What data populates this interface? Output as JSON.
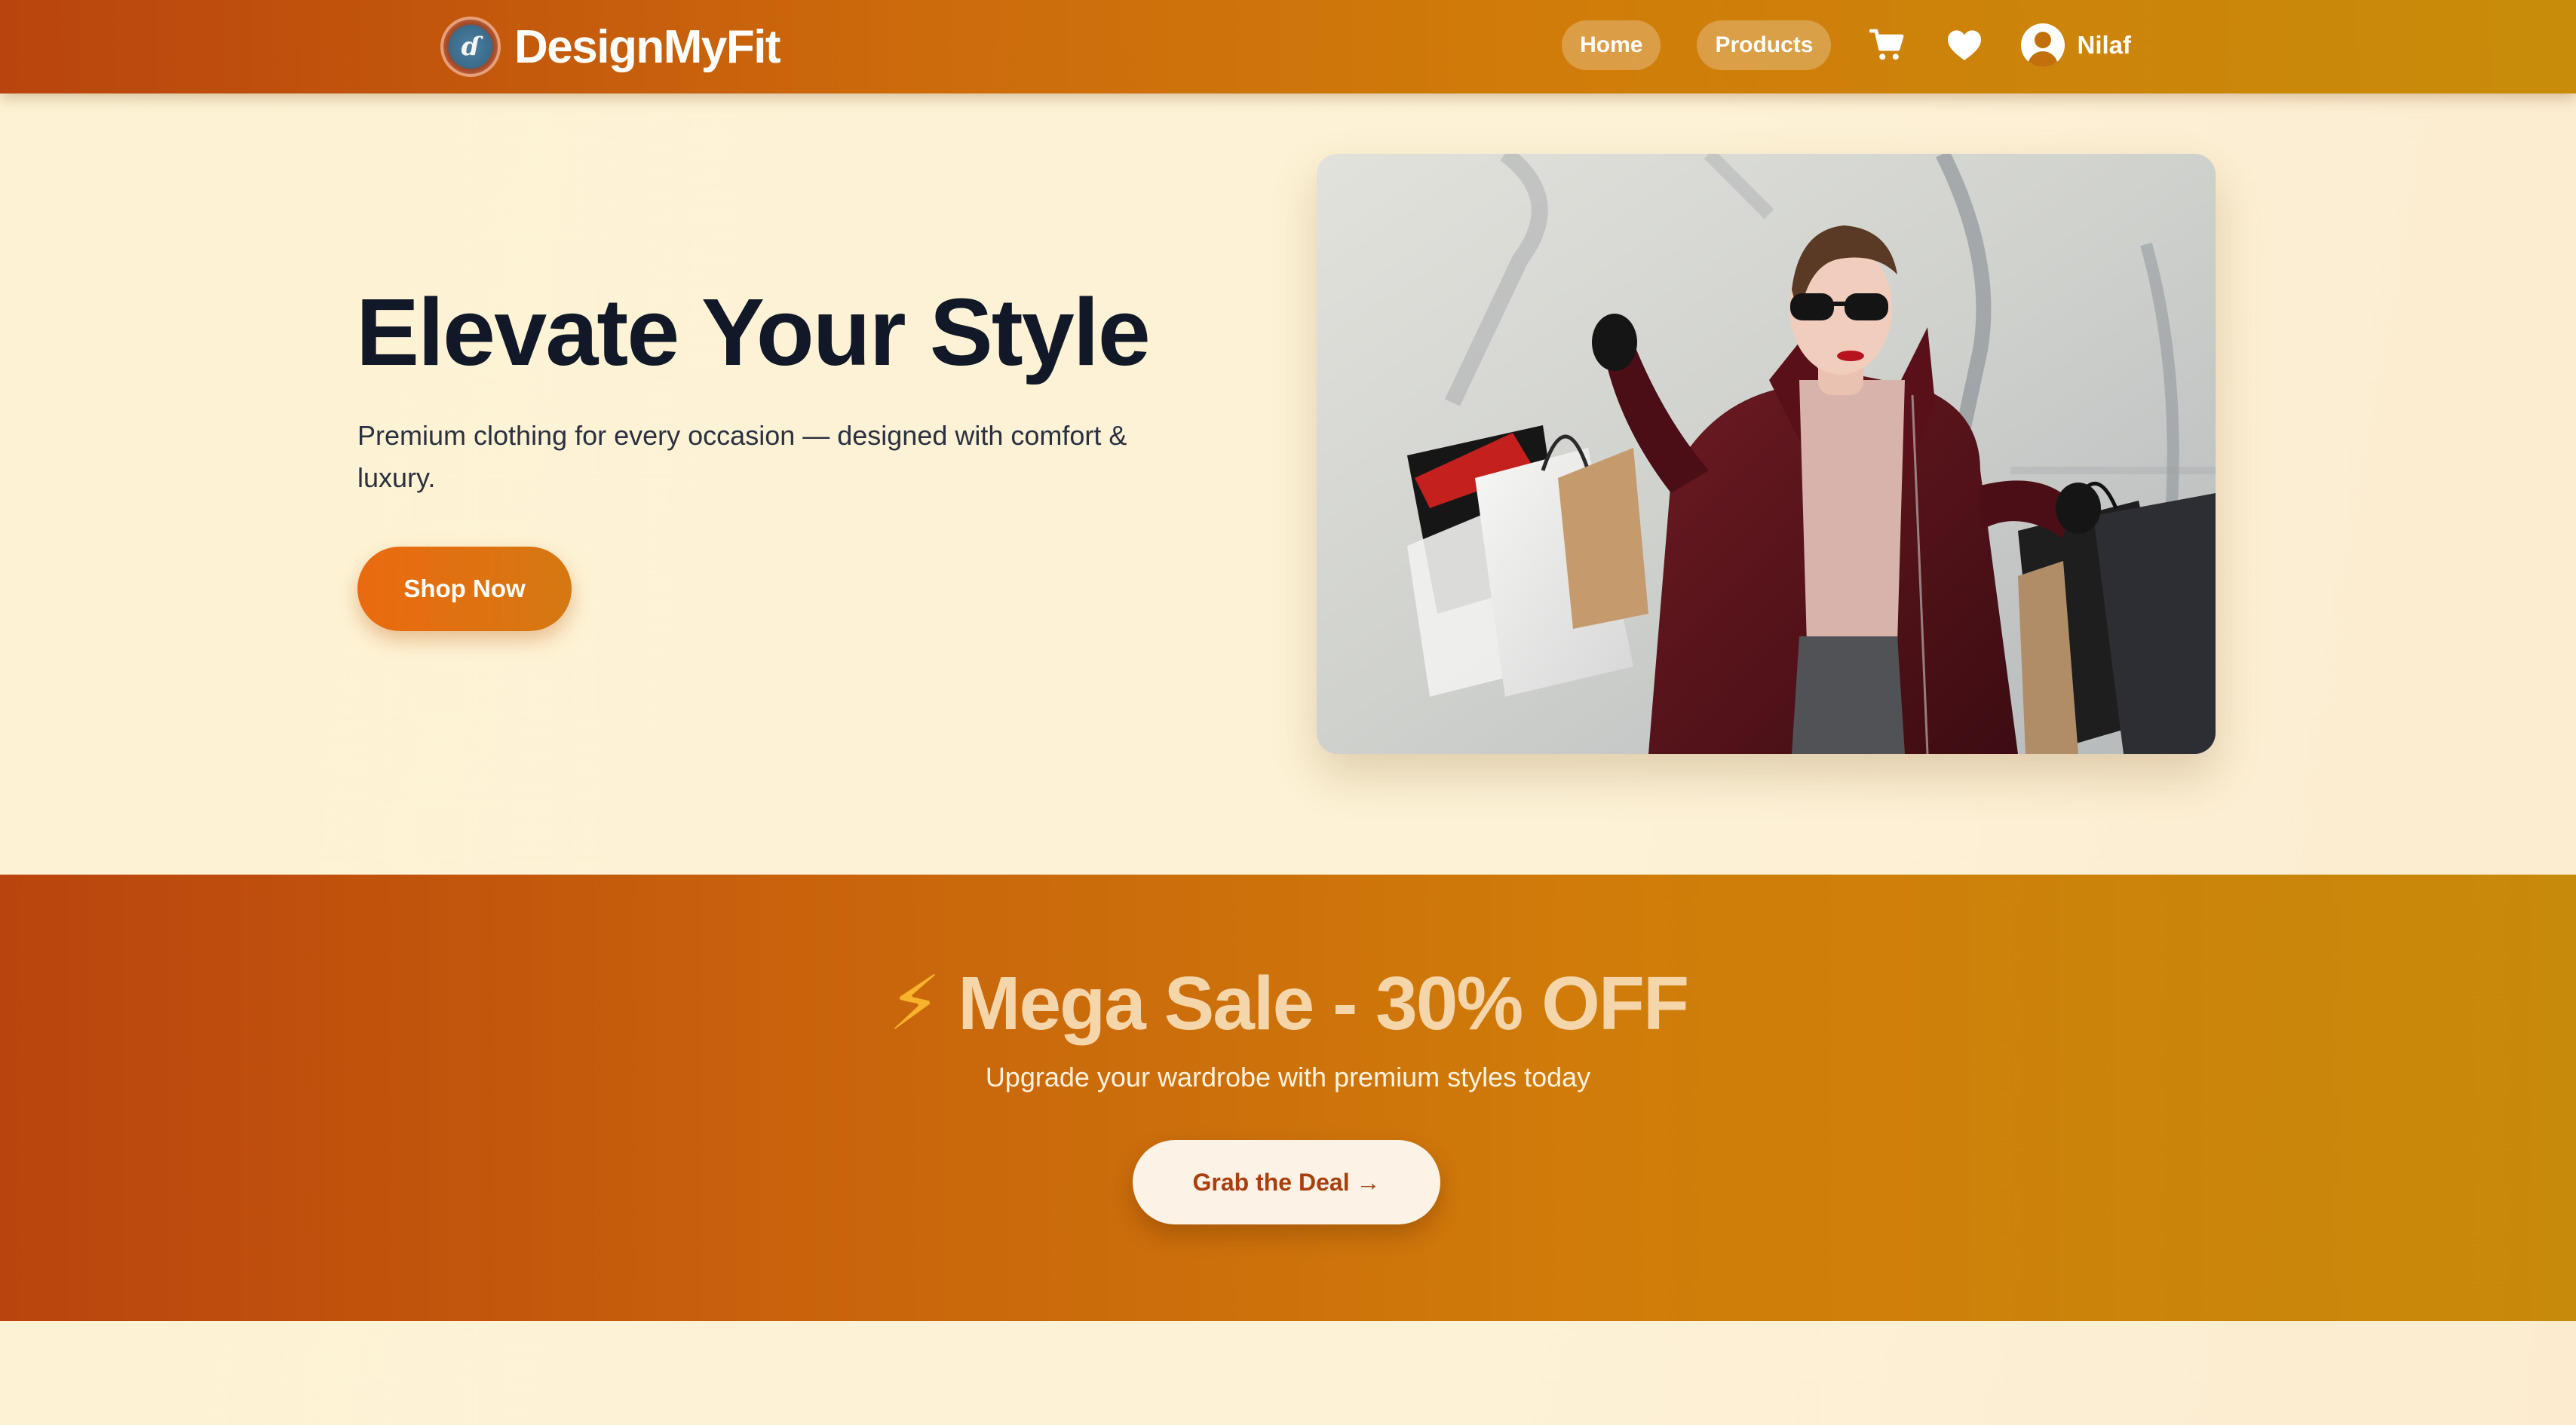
{
  "navbar": {
    "brand_logo_glyph": "ɗ",
    "brand_name": "DesignMyFit",
    "links": [
      {
        "label": "Home"
      },
      {
        "label": "Products"
      }
    ],
    "icons": {
      "cart": "cart-icon",
      "wishlist": "heart-icon",
      "user": "user-avatar-icon"
    },
    "user_name": "Nilaf"
  },
  "hero": {
    "title": "Elevate Your Style",
    "subtitle": "Premium clothing for every occasion — designed with comfort & luxury.",
    "cta_label": "Shop Now",
    "image_alt": "Woman in burgundy coat and sunglasses holding shopping bags"
  },
  "sale": {
    "icon": "⚡",
    "title": "Mega Sale - 30% OFF",
    "subtitle": "Upgrade your wardrobe with premium styles today",
    "cta_label": "Grab the Deal →"
  },
  "colors": {
    "brand_gradient_start": "#b9440d",
    "brand_gradient_end": "#c88c0a",
    "page_background": "#fdf3d4",
    "cta_orange": "#ea6a10",
    "heading_dark": "#111827"
  }
}
